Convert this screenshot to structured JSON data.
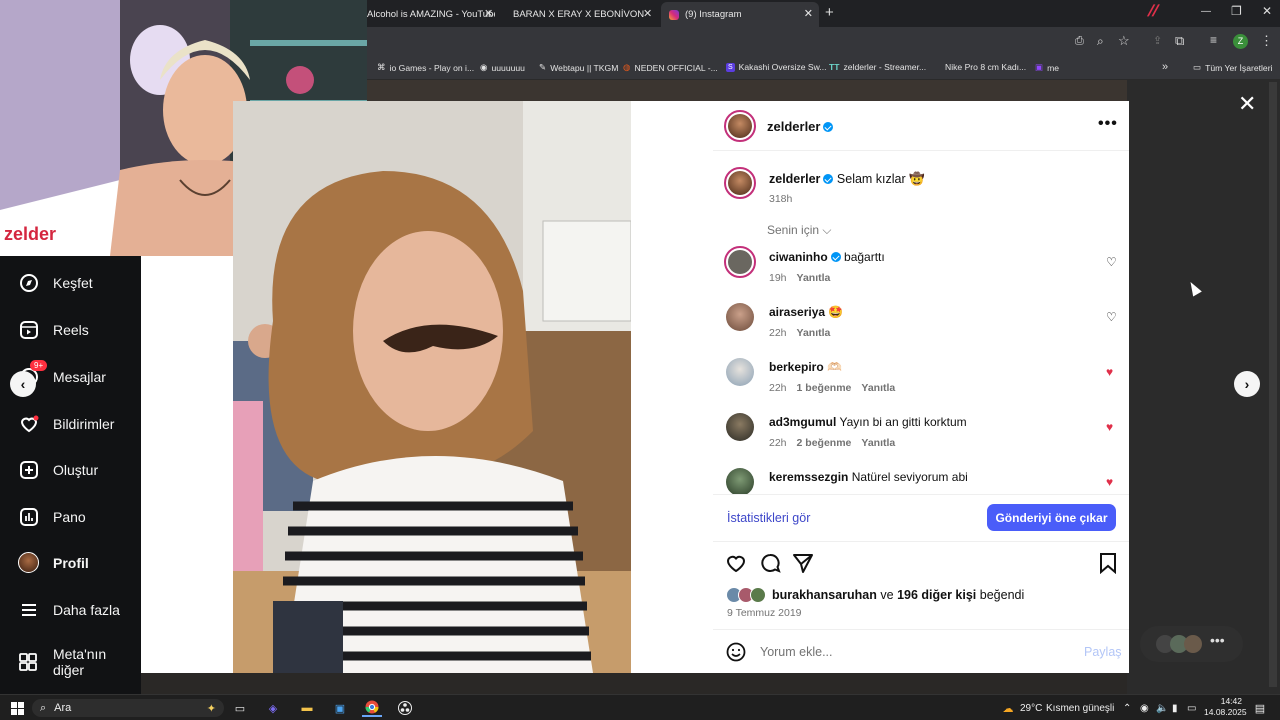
{
  "browser": {
    "tabs": [
      {
        "title": "Alcohol is AMAZING - YouTube"
      },
      {
        "title": "BARAN X ERAY X EBONİVON X"
      },
      {
        "title": "(9) Instagram"
      }
    ],
    "new_tab": "+",
    "bookmarks": [
      {
        "label": "io Games - Play on i..."
      },
      {
        "label": "uuuuuuu"
      },
      {
        "label": "Webtapu || TKGM"
      },
      {
        "label": "NEDEN OFFICIAL -..."
      },
      {
        "label": "Kakashi Oversize Sw..."
      },
      {
        "label": "zelderler - Streamer..."
      },
      {
        "label": "Nike Pro 8 cm Kadı..."
      },
      {
        "label": "me"
      }
    ],
    "all_bookmarks": "Tüm Yer İşaretleri",
    "profile_initial": "Z"
  },
  "sidebar": {
    "items": [
      {
        "label": "Keşfet",
        "icon": "compass-icon"
      },
      {
        "label": "Reels",
        "icon": "reels-icon"
      },
      {
        "label": "Mesajlar",
        "icon": "messenger-icon",
        "badge": "9+"
      },
      {
        "label": "Bildirimler",
        "icon": "heart-icon"
      },
      {
        "label": "Oluştur",
        "icon": "plus-square-icon"
      },
      {
        "label": "Pano",
        "icon": "dashboard-icon"
      },
      {
        "label": "Profil",
        "icon": "profile-avatar"
      },
      {
        "label": "Daha fazla",
        "icon": "menu-icon"
      },
      {
        "label": "Meta'nın diğer",
        "icon": "meta-icon"
      }
    ]
  },
  "post": {
    "author": "zelderler",
    "caption_user": "zelderler",
    "caption": "Selam kızlar 🤠",
    "caption_time": "318h",
    "for_you": "Senin için",
    "comments": [
      {
        "user": "ciwaninho",
        "verified": true,
        "text": "bağarttı",
        "time": "19h",
        "likes": "",
        "reply": "Yanıtla",
        "liked": false
      },
      {
        "user": "airaseriya",
        "verified": false,
        "text": "🤩",
        "time": "22h",
        "likes": "",
        "reply": "Yanıtla",
        "liked": false
      },
      {
        "user": "berkepiro",
        "verified": false,
        "text": "🫶🏻",
        "time": "22h",
        "likes": "1 beğenme",
        "reply": "Yanıtla",
        "liked": true
      },
      {
        "user": "ad3mgumul",
        "verified": false,
        "text": "Yayın bi an gitti korktum",
        "time": "22h",
        "likes": "2 beğenme",
        "reply": "Yanıtla",
        "liked": true
      },
      {
        "user": "keremssezgin",
        "verified": false,
        "text": "Natürel seviyorum abi",
        "time": "",
        "likes": "",
        "reply": "",
        "liked": true
      }
    ],
    "stats_link": "İstatistikleri gör",
    "boost_button": "Gönderiyi öne çıkar",
    "liked_by_user": "burakhansaruhan",
    "liked_by_joiner": "ve",
    "liked_by_others": "196 diğer kişi",
    "liked_by_suffix": "beğendi",
    "date": "9 Temmuz 2019",
    "comment_placeholder": "Yorum ekle...",
    "share_label": "Paylaş"
  },
  "taskbar": {
    "search": "Ara",
    "weather_temp": "29°C",
    "weather_text": "Kısmen güneşli",
    "time": "14:42",
    "date": "14.08.2025"
  },
  "colors": {
    "accent_blue": "#4a5df9",
    "link_blue": "#3d46c9",
    "heart_red": "#e0304a",
    "verified": "#0095f6"
  }
}
